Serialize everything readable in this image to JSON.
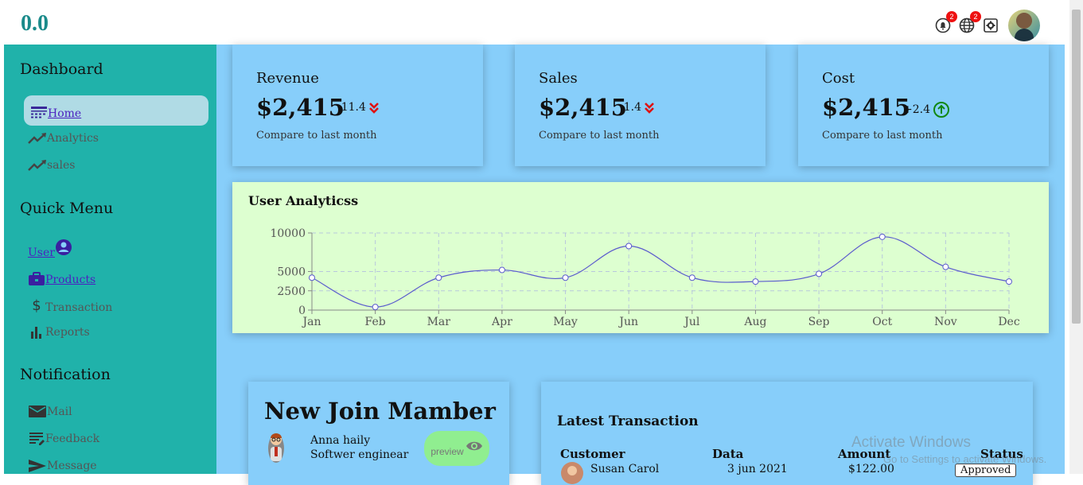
{
  "logo": "0.0",
  "header": {
    "notification_badge": "2",
    "language_badge": "2"
  },
  "sidebar": {
    "sections": [
      {
        "title": "Dashboard",
        "items": [
          {
            "label": "Home"
          },
          {
            "label": "Analytics"
          },
          {
            "label": "sales"
          }
        ]
      },
      {
        "title": "Quick Menu",
        "items": [
          {
            "label": "User"
          },
          {
            "label": "Products"
          },
          {
            "label": "Transaction"
          },
          {
            "label": "Reports"
          }
        ]
      },
      {
        "title": "Notification",
        "items": [
          {
            "label": "Mail"
          },
          {
            "label": "Feedback"
          },
          {
            "label": "Message"
          }
        ]
      }
    ]
  },
  "cards": [
    {
      "title": "Revenue",
      "value": "$2,415",
      "delta": "-11.4",
      "trend": "down",
      "note": "Compare to last month"
    },
    {
      "title": "Sales",
      "value": "$2,415",
      "delta": "-1.4",
      "trend": "down",
      "note": "Compare to last month"
    },
    {
      "title": "Cost",
      "value": "$2,415",
      "delta": "+2.4",
      "trend": "up",
      "note": "Compare to last month"
    }
  ],
  "colors": {
    "teal": "#20b2aa",
    "sky": "#87cefa",
    "chart_bg": "#ddffd0",
    "down_red": "#e01010",
    "up_green": "#118811",
    "line": "#5a5acd"
  },
  "chart_data": {
    "type": "line",
    "title": "User Analyticss",
    "categories": [
      "Jan",
      "Feb",
      "Mar",
      "Apr",
      "May",
      "Jun",
      "Jul",
      "Aug",
      "Sep",
      "Oct",
      "Nov",
      "Dec"
    ],
    "values": [
      4200,
      400,
      4200,
      5200,
      4200,
      8300,
      4200,
      3700,
      4700,
      9500,
      5600,
      3700
    ],
    "yticks": [
      0,
      2500,
      5000,
      10000
    ],
    "ylim": [
      0,
      10000
    ],
    "grid": true
  },
  "members": {
    "title": "New Join Mamber",
    "items": [
      {
        "name": "Anna haily",
        "role": "Softwer enginear",
        "button": "preview"
      }
    ]
  },
  "transactions": {
    "title": "Latest Transaction",
    "headers": [
      "Customer",
      "Data",
      "Amount",
      "Status"
    ],
    "rows": [
      {
        "customer": "Susan Carol",
        "date": "3 jun 2021",
        "amount": "$122.00",
        "status": "Approved"
      }
    ]
  },
  "watermark": {
    "line1": "Activate Windows",
    "line2": "Go to Settings to activate Windows."
  }
}
